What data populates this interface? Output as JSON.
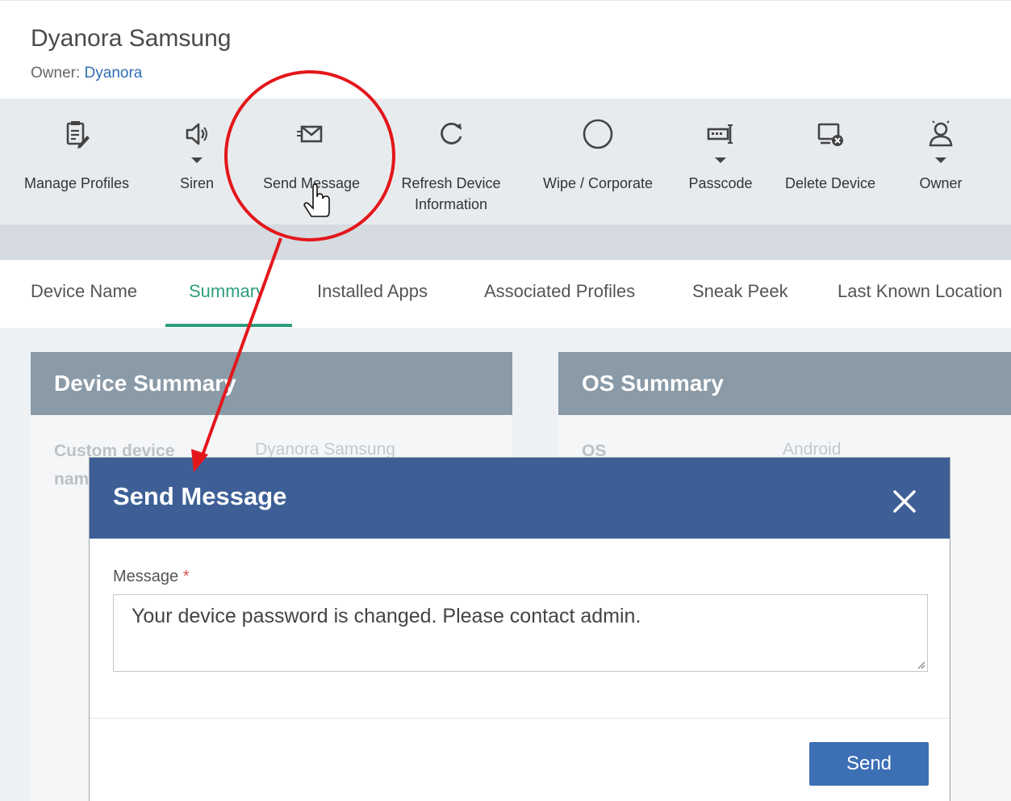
{
  "header": {
    "title": "Dyanora Samsung",
    "owner_label": "Owner:",
    "owner_name": "Dyanora"
  },
  "toolbar": {
    "items": [
      {
        "label": "Manage Profiles",
        "icon": "clipboard-edit-icon",
        "dropdown": false
      },
      {
        "label": "Siren",
        "icon": "speaker-icon",
        "dropdown": true
      },
      {
        "label": "Send Message",
        "icon": "envelope-icon",
        "dropdown": false
      },
      {
        "label": "Refresh Device\nInformation",
        "icon": "refresh-icon",
        "dropdown": false
      },
      {
        "label": "Wipe / Corporate",
        "icon": "circle-icon",
        "dropdown": false
      },
      {
        "label": "Passcode",
        "icon": "passcode-icon",
        "dropdown": true
      },
      {
        "label": "Delete Device",
        "icon": "device-delete-icon",
        "dropdown": false
      },
      {
        "label": "Owner",
        "icon": "user-icon",
        "dropdown": true
      }
    ]
  },
  "tabs": [
    {
      "label": "Device Name",
      "active": false
    },
    {
      "label": "Summary",
      "active": true
    },
    {
      "label": "Installed Apps",
      "active": false
    },
    {
      "label": "Associated Profiles",
      "active": false
    },
    {
      "label": "Sneak Peek",
      "active": false
    },
    {
      "label": "Last Known Location",
      "active": false
    }
  ],
  "device_summary": {
    "title": "Device Summary",
    "row_label": "Custom device name",
    "row_label_part1": "Custom device",
    "row_label_part2": "nam",
    "row_value": "Dyanora Samsung"
  },
  "os_summary": {
    "title": "OS Summary",
    "row_label": "OS",
    "row_value": "Android"
  },
  "modal": {
    "title": "Send Message",
    "field_label": "Message",
    "required_mark": "*",
    "message_value": "Your device password is changed. Please contact admin.",
    "send_label": "Send"
  },
  "colors": {
    "accent": "#2e9e7e",
    "modal_header": "#3d5f96",
    "button": "#3d6fb5",
    "annotation": "#e3171b",
    "link": "#2f6db5"
  }
}
